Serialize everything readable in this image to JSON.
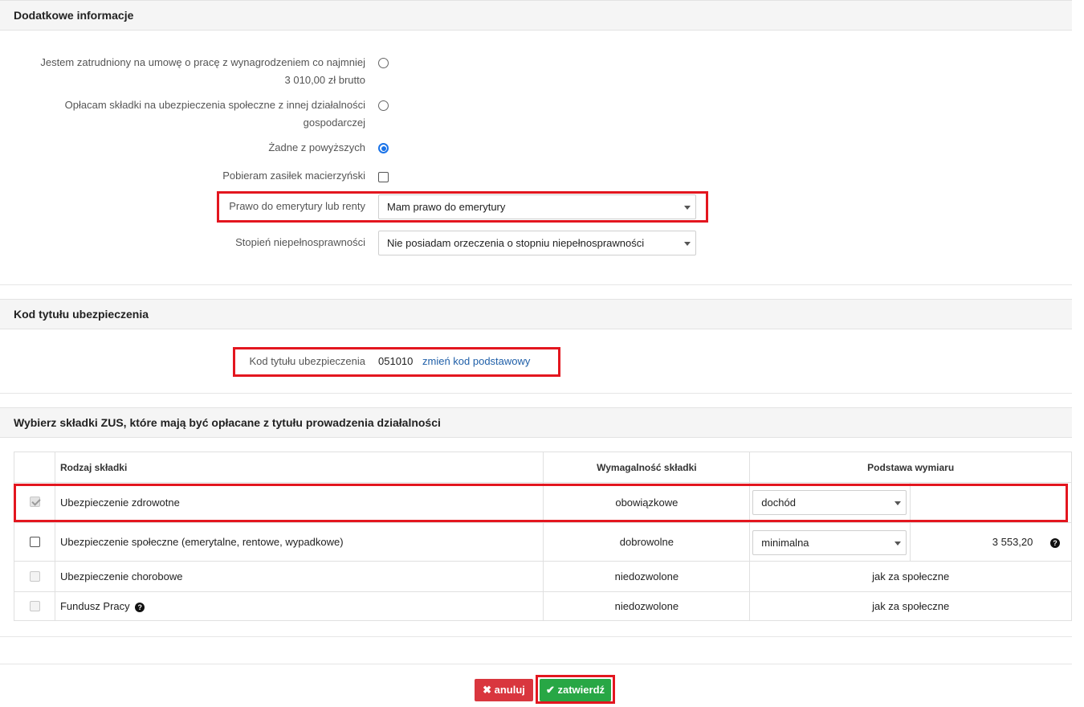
{
  "section1": {
    "title": "Dodatkowe informacje",
    "options": [
      {
        "label_line1": "Jestem zatrudniony na umowę o pracę z wynagrodzeniem co najmniej",
        "label_line2": "3 010,00 zł brutto",
        "selected": false
      },
      {
        "label_line1": "Opłacam składki na ubezpieczenia społeczne z innej działalności",
        "label_line2": "gospodarczej",
        "selected": false
      },
      {
        "label_line1": "Żadne z powyższych",
        "selected": true
      }
    ],
    "maternity_label": "Pobieram zasiłek macierzyński",
    "pension_label": "Prawo do emerytury lub renty",
    "pension_value": "Mam prawo do emerytury",
    "disability_label": "Stopień niepełnosprawności",
    "disability_value": "Nie posiadam orzeczenia o stopniu niepełnosprawności"
  },
  "section2": {
    "title": "Kod tytułu ubezpieczenia",
    "code_label": "Kod tytułu ubezpieczenia",
    "code_value": "051010",
    "change_link": "zmień kod podstawowy"
  },
  "section3": {
    "title": "Wybierz składki ZUS, które mają być opłacane z tytułu prowadzenia działalności",
    "columns": [
      "Rodzaj składki",
      "Wymagalność składki",
      "Podstawa wymiaru"
    ],
    "rows": [
      {
        "name": "Ubezpieczenie zdrowotne",
        "req": "obowiązkowe",
        "basis_select": "dochód",
        "amount": ""
      },
      {
        "name": "Ubezpieczenie społeczne (emerytalne, rentowe, wypadkowe)",
        "req": "dobrowolne",
        "basis_select": "minimalna",
        "amount": "3 553,20"
      },
      {
        "name": "Ubezpieczenie chorobowe",
        "req": "niedozwolone",
        "basis_text": "jak za społeczne"
      },
      {
        "name": "Fundusz Pracy",
        "req": "niedozwolone",
        "basis_text": "jak za społeczne"
      }
    ]
  },
  "footer": {
    "cancel_label": "anuluj",
    "confirm_label": "zatwierdź",
    "cancel_color": "#d9363e",
    "confirm_color": "#28a745"
  },
  "highlight_color": "#e3161f"
}
